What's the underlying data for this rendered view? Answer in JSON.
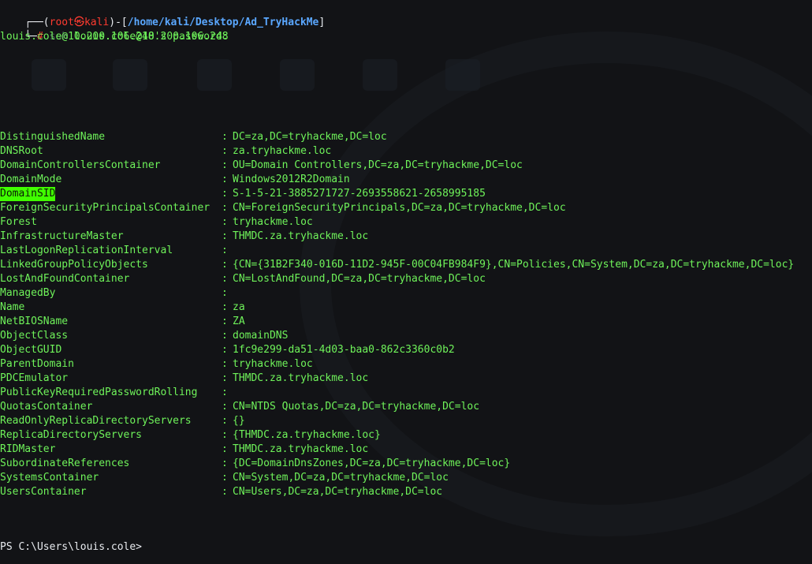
{
  "prompt": {
    "box_top": "┌──(",
    "user": "root",
    "at": "㉿",
    "host": "kali",
    "mid": ")-[",
    "path": "/home/kali/Desktop/Ad_TryHackMe",
    "end": "]",
    "box_bottom": "└─",
    "hash": "#",
    "cmd": "ssh",
    "cmd_arg": "louis.cole@10.200.106.248"
  },
  "password_prompt": "louis.cole@10.200.106.248's password:",
  "properties": [
    {
      "key": "DistinguishedName",
      "value": "DC=za,DC=tryhackme,DC=loc"
    },
    {
      "key": "DNSRoot",
      "value": "za.tryhackme.loc"
    },
    {
      "key": "DomainControllersContainer",
      "value": "OU=Domain Controllers,DC=za,DC=tryhackme,DC=loc"
    },
    {
      "key": "DomainMode",
      "value": "Windows2012R2Domain"
    },
    {
      "key": "DomainSID",
      "value": "S-1-5-21-3885271727-2693558621-2658995185",
      "highlight": true
    },
    {
      "key": "ForeignSecurityPrincipalsContainer",
      "value": "CN=ForeignSecurityPrincipals,DC=za,DC=tryhackme,DC=loc"
    },
    {
      "key": "Forest",
      "value": "tryhackme.loc"
    },
    {
      "key": "InfrastructureMaster",
      "value": "THMDC.za.tryhackme.loc"
    },
    {
      "key": "LastLogonReplicationInterval",
      "value": ""
    },
    {
      "key": "LinkedGroupPolicyObjects",
      "value": "{CN={31B2F340-016D-11D2-945F-00C04FB984F9},CN=Policies,CN=System,DC=za,DC=tryhackme,DC=loc}"
    },
    {
      "key": "LostAndFoundContainer",
      "value": "CN=LostAndFound,DC=za,DC=tryhackme,DC=loc"
    },
    {
      "key": "ManagedBy",
      "value": ""
    },
    {
      "key": "Name",
      "value": "za"
    },
    {
      "key": "NetBIOSName",
      "value": "ZA"
    },
    {
      "key": "ObjectClass",
      "value": "domainDNS"
    },
    {
      "key": "ObjectGUID",
      "value": "1fc9e299-da51-4d03-baa0-862c3360c0b2"
    },
    {
      "key": "ParentDomain",
      "value": "tryhackme.loc"
    },
    {
      "key": "PDCEmulator",
      "value": "THMDC.za.tryhackme.loc"
    },
    {
      "key": "PublicKeyRequiredPasswordRolling",
      "value": ""
    },
    {
      "key": "QuotasContainer",
      "value": "CN=NTDS Quotas,DC=za,DC=tryhackme,DC=loc"
    },
    {
      "key": "ReadOnlyReplicaDirectoryServers",
      "value": "{}"
    },
    {
      "key": "ReplicaDirectoryServers",
      "value": "{THMDC.za.tryhackme.loc}"
    },
    {
      "key": "RIDMaster",
      "value": "THMDC.za.tryhackme.loc"
    },
    {
      "key": "SubordinateReferences",
      "value": "{DC=DomainDnsZones,DC=za,DC=tryhackme,DC=loc}"
    },
    {
      "key": "SystemsContainer",
      "value": "CN=System,DC=za,DC=tryhackme,DC=loc"
    },
    {
      "key": "UsersContainer",
      "value": "CN=Users,DC=za,DC=tryhackme,DC=loc"
    }
  ],
  "separator": ":",
  "ps_prompt": "PS C:\\Users\\louis.cole>",
  "colors": {
    "background": "#121316",
    "output_green": "#6ff35a",
    "highlight": "#40ff00",
    "user_red": "#ff3b30",
    "path_blue": "#5aa7ff"
  }
}
